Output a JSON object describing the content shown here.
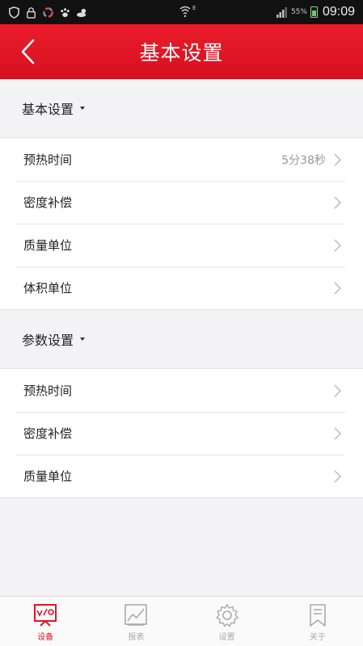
{
  "status_bar": {
    "network": "E",
    "battery": "55%",
    "time": "09:09"
  },
  "header": {
    "title": "基本设置"
  },
  "sections": [
    {
      "title": "基本设置",
      "rows": [
        {
          "label": "预热时间",
          "value": "5分38秒"
        },
        {
          "label": "密度补偿",
          "value": ""
        },
        {
          "label": "质量单位",
          "value": ""
        },
        {
          "label": "体积单位",
          "value": ""
        }
      ]
    },
    {
      "title": "参数设置",
      "rows": [
        {
          "label": "预热时间",
          "value": ""
        },
        {
          "label": "密度补偿",
          "value": ""
        },
        {
          "label": "质量单位",
          "value": ""
        }
      ]
    }
  ],
  "tabbar": {
    "items": [
      {
        "label": "设备",
        "icon": "device-monitor-icon",
        "active": true
      },
      {
        "label": "报表",
        "icon": "chart-icon",
        "active": false
      },
      {
        "label": "设置",
        "icon": "gear-icon",
        "active": false
      },
      {
        "label": "关于",
        "icon": "bookmark-icon",
        "active": false
      }
    ]
  },
  "colors": {
    "accent": "#e0192a",
    "background": "#f3f3f5",
    "tab_inactive": "#aaaaaa"
  }
}
